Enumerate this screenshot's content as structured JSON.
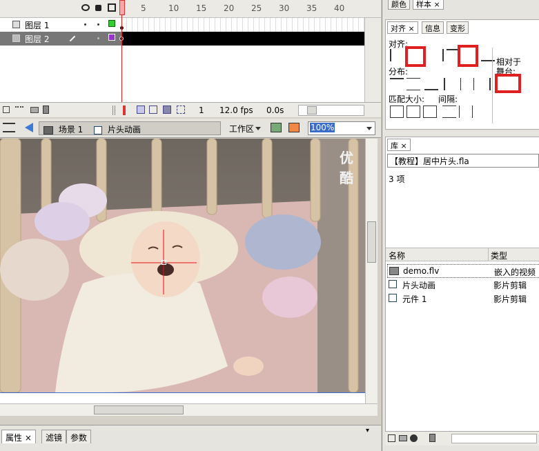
{
  "timeline": {
    "frame_numbers": [
      "5",
      "10",
      "15",
      "20",
      "25",
      "30",
      "35",
      "40"
    ],
    "layers": [
      {
        "name": "图层 1"
      },
      {
        "name": "图层 2"
      }
    ],
    "status": {
      "frame": "1",
      "fps": "12.0 fps",
      "time": "0.0s"
    }
  },
  "editbar": {
    "scene_label": "场景 1",
    "symbol_label": "片头动画",
    "workspace_label": "工作区",
    "zoom_value": "100%"
  },
  "stage": {
    "watermark": "优酷"
  },
  "properties": {
    "tabs": [
      "属性",
      "滤镜",
      "参数"
    ]
  },
  "right_panel": {
    "top_tabs": [
      "颜色",
      "样本"
    ],
    "align_tabs": [
      "对齐",
      "信息",
      "变形"
    ],
    "align_label": "对齐:",
    "distribute_label": "分布:",
    "match_size_label": "匹配大小:",
    "spacing_label": "间隔:",
    "relative_label_1": "相对于",
    "relative_label_2": "舞台:",
    "library_tab": "库",
    "library_file": "【教程】居中片头.fla",
    "item_count": "3 项",
    "col_name": "名称",
    "col_type": "类型",
    "items": [
      {
        "name": "demo.flv",
        "type": "嵌入的视频",
        "icon": "video-icon"
      },
      {
        "name": "片头动画",
        "type": "影片剪辑",
        "icon": "movieclip-icon"
      },
      {
        "name": "元件 1",
        "type": "影片剪辑",
        "icon": "movieclip-icon"
      }
    ]
  }
}
